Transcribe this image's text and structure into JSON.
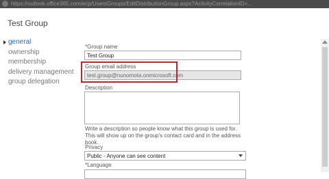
{
  "browser": {
    "url": "https://outlook.office365.com/ecp/UsersGroups/EditDistributionGroup.aspx?ActivityCorrelationID=..."
  },
  "page": {
    "title": "Test Group"
  },
  "nav": {
    "items": [
      {
        "label": "general",
        "active": true
      },
      {
        "label": "ownership",
        "active": false
      },
      {
        "label": "membership",
        "active": false
      },
      {
        "label": "delivery management",
        "active": false
      },
      {
        "label": "group delegation",
        "active": false
      }
    ]
  },
  "form": {
    "group_name": {
      "label": "*Group name",
      "value": "Test Group"
    },
    "group_email": {
      "label": "Group email address",
      "value": "test.group@nunomota.onmicrosoft.com"
    },
    "description": {
      "label": "Description",
      "value": "",
      "help": "Write a description so people know what this group is used for. This will show up on the group's contact card and in the address book."
    },
    "privacy": {
      "label": "Privacy",
      "value": "Public - Anyone can see content"
    },
    "language": {
      "label": "*Language"
    }
  },
  "colors": {
    "highlight": "#c0262d",
    "active_nav": "#1c6bc6"
  }
}
